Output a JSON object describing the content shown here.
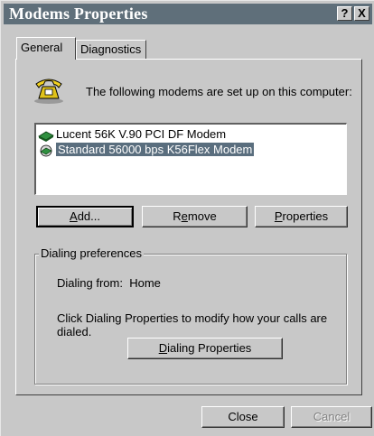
{
  "window": {
    "title": "Modems Properties",
    "help_glyph": "?",
    "close_glyph": "X"
  },
  "tabs": [
    {
      "label": "General",
      "selected": true
    },
    {
      "label": "Diagnostics",
      "selected": false
    }
  ],
  "general": {
    "intro": "The following modems are set up on this computer:",
    "modems": [
      {
        "name": "Lucent 56K V.90 PCI DF Modem",
        "selected": false
      },
      {
        "name": "Standard 56000 bps K56Flex Modem",
        "selected": true
      }
    ],
    "buttons": {
      "add_prefix": "A",
      "add_rest": "dd...",
      "remove_prefix": "R",
      "remove_mn": "e",
      "remove_rest": "move",
      "properties_mn": "P",
      "properties_rest": "roperties"
    },
    "dialing": {
      "group_label": "Dialing preferences",
      "from_label": "Dialing from:",
      "from_value": "Home",
      "description": "Click Dialing Properties to modify how your calls are dialed.",
      "button_mn": "D",
      "button_rest": "ialing Properties"
    }
  },
  "footer": {
    "close_label": "Close",
    "cancel_label": "Cancel"
  },
  "colors": {
    "titlebar": "#5f6f7a",
    "face": "#c8c8c8",
    "selection": "#5a6e7e"
  }
}
